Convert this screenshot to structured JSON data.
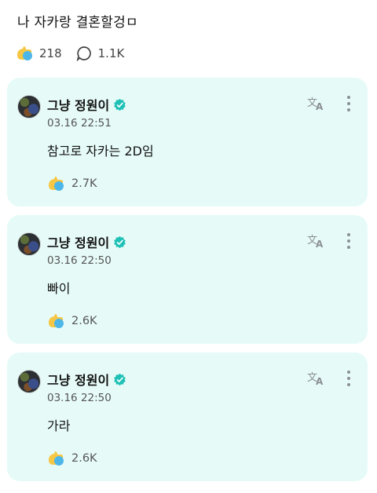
{
  "post": {
    "title": "나 자카랑 결혼할겅ㅁ",
    "likes": "218",
    "comments": "1.1K"
  },
  "icons": {
    "like": "thumbs-up-reaction-icon",
    "comment": "speech-bubble-icon",
    "verified": "verified-badge-icon",
    "translate": "translate-icon",
    "more": "more-vertical-icon"
  },
  "colors": {
    "card_bg": "#e6fbf8",
    "verified": "#1fc1b6"
  },
  "replies": [
    {
      "author": "그냥 정원이",
      "timestamp": "03.16 22:51",
      "text": "참고로 자카는 2D임",
      "likes": "2.7K"
    },
    {
      "author": "그냥 정원이",
      "timestamp": "03.16 22:50",
      "text": "빠이",
      "likes": "2.6K"
    },
    {
      "author": "그냥 정원이",
      "timestamp": "03.16 22:50",
      "text": "가라",
      "likes": "2.6K"
    }
  ]
}
